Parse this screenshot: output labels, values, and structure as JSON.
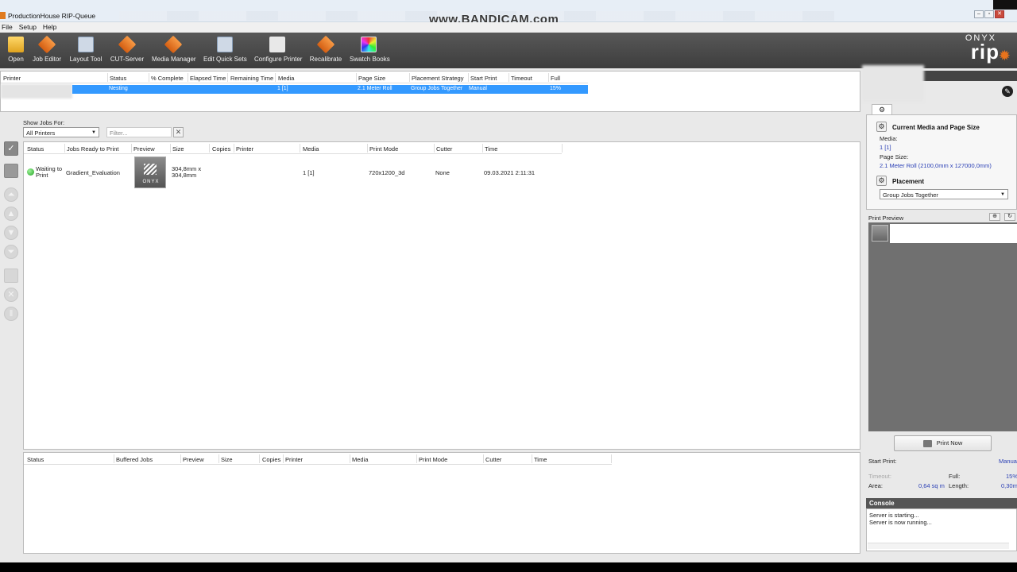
{
  "window": {
    "title": "ProductionHouse RIP-Queue",
    "watermark": "www.BANDICAM.com",
    "minimize": "–",
    "restore": "▫",
    "close": "✕"
  },
  "menu": [
    "File",
    "Setup",
    "Help"
  ],
  "toolbar": [
    {
      "label": "Open",
      "icon": "folder-icon"
    },
    {
      "label": "Job Editor",
      "icon": "job-editor-icon"
    },
    {
      "label": "Layout Tool",
      "icon": "layout-tool-icon"
    },
    {
      "label": "CUT-Server",
      "icon": "cut-server-icon"
    },
    {
      "label": "Media Manager",
      "icon": "media-manager-icon"
    },
    {
      "label": "Edit Quick Sets",
      "icon": "quick-sets-icon"
    },
    {
      "label": "Configure Printer",
      "icon": "printer-icon"
    },
    {
      "label": "Recalibrate",
      "icon": "recalibrate-icon"
    },
    {
      "label": "Swatch Books",
      "icon": "swatch-books-icon"
    }
  ],
  "brand": {
    "onyx": "ONYX",
    "rip": "rip"
  },
  "printer_table": {
    "headers": [
      "Printer",
      "Status",
      "% Complete",
      "Elapsed Time",
      "Remaining Time",
      "Media",
      "Page Size",
      "Placement Strategy",
      "Start Print",
      "Timeout",
      "Full"
    ],
    "row": {
      "printer": "",
      "status": "Nesting",
      "media": "1 [1]",
      "page_size": "2.1 Meter Roll",
      "placement": "Group Jobs Together",
      "start_print": "Manual",
      "full": "15%"
    }
  },
  "filters": {
    "show_jobs_for_label": "Show Jobs For:",
    "printer_select": "All Printers",
    "filter_placeholder": "Filter..."
  },
  "jobs_table": {
    "headers": [
      "Status",
      "Jobs Ready to Print",
      "Preview",
      "Size",
      "Copies",
      "Printer",
      "Media",
      "Print Mode",
      "Cutter",
      "Time"
    ],
    "rows": [
      {
        "status": "Waiting to Print",
        "status_color": "#2fb52f",
        "name": "Gradient_Evaluation",
        "preview_text": "ONYX",
        "size": "304,8mm x 304,8mm",
        "copies": "",
        "printer": "",
        "media": "1 [1]",
        "print_mode": "720x1200_3d",
        "cutter": "None",
        "time": "09.03.2021 2:11:31"
      }
    ]
  },
  "buffered_table": {
    "headers": [
      "Status",
      "Buffered Jobs",
      "Preview",
      "Size",
      "Copies",
      "Printer",
      "Media",
      "Print Mode",
      "Cutter",
      "Time"
    ]
  },
  "right_panel": {
    "media_section_title": "Current Media and Page Size",
    "media_label": "Media:",
    "media_value": "1 [1]",
    "page_size_label": "Page Size:",
    "page_size_value": "2.1 Meter Roll (2100,0mm x 127000,0mm)",
    "placement_title": "Placement",
    "placement_value": "Group Jobs Together",
    "print_preview_label": "Print Preview",
    "print_now": "Print Now",
    "start_print_label": "Start Print:",
    "start_print_value": "Manual",
    "timeout_label": "Timeout:",
    "full_label": "Full:",
    "full_value": "15%",
    "area_label": "Area:",
    "area_value": "0,64 sq m",
    "length_label": "Length:",
    "length_value": "0,30m"
  },
  "console": {
    "title": "Console",
    "lines": [
      "Server is starting...",
      "Server is now running..."
    ]
  }
}
